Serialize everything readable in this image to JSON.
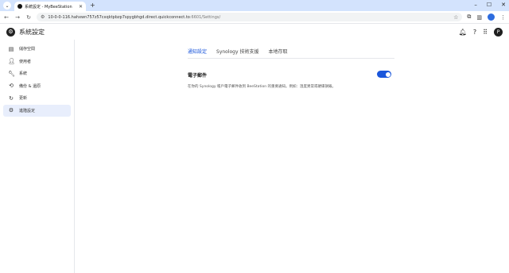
{
  "browser": {
    "tab_title": "系統設定 - MyBeeStation",
    "new_tab": "+",
    "close": "✕",
    "url_host": "10-0-0-116.hahxwn757z57cxqktpbzp7spygbhgd.direct.quickconnect.to",
    "url_path": ":6601/Settings/"
  },
  "app": {
    "title": "系統設定",
    "user_initial": "P"
  },
  "sidebar": {
    "items": [
      {
        "label": "儲存空間",
        "icon": "storage-icon"
      },
      {
        "label": "使用者",
        "icon": "user-icon"
      },
      {
        "label": "系統",
        "icon": "wrench-icon"
      },
      {
        "label": "備份 & 還原",
        "icon": "backup-icon"
      },
      {
        "label": "更新",
        "icon": "refresh-icon"
      },
      {
        "label": "進階設定",
        "icon": "settings-icon"
      }
    ],
    "active_index": 5
  },
  "tabs": [
    {
      "label": "通知設定"
    },
    {
      "label": "Synology 技術支援"
    },
    {
      "label": "本地存取"
    }
  ],
  "email": {
    "title": "電子郵件",
    "description": "在你的 Synology 帳戶電子郵件收到 BeeStation 的重要通知。例如：溫度異常或硬碟損毀。",
    "enabled": true
  },
  "colors": {
    "accent": "#1a56db",
    "tabstrip": "#d3e3fd",
    "sidebar_active": "#e8eefc"
  }
}
